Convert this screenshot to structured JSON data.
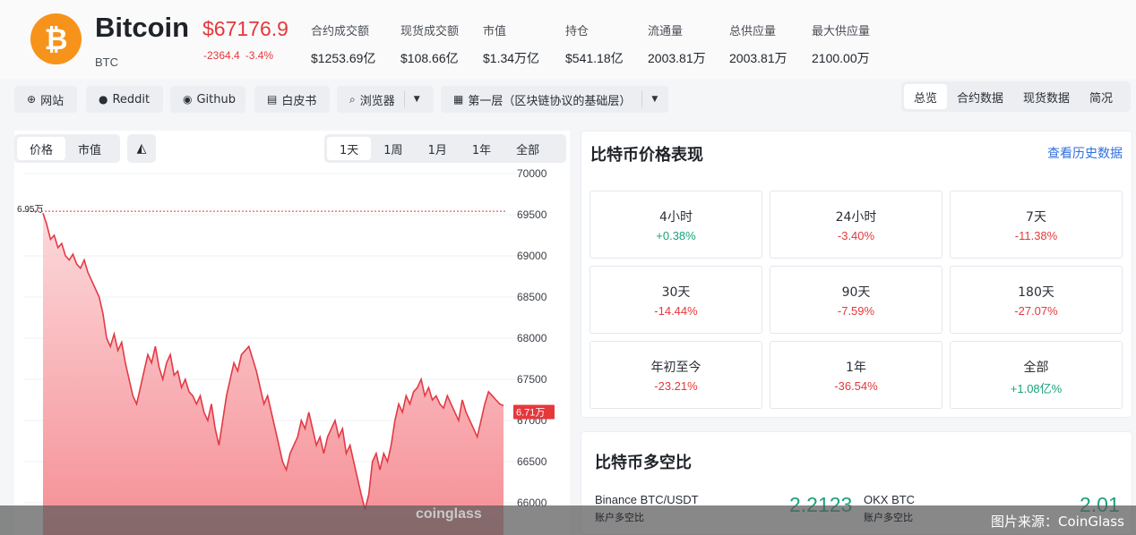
{
  "coin": {
    "name": "Bitcoin",
    "symbol": "BTC",
    "logo_glyph": "₿",
    "price": "$67176.9",
    "change_abs": "-2364.4",
    "change_pct": "-3.4%"
  },
  "stats": [
    {
      "label": "合约成交额",
      "value": "$1253.69亿"
    },
    {
      "label": "现货成交额",
      "value": "$108.66亿"
    },
    {
      "label": "市值",
      "value": "$1.34万亿"
    },
    {
      "label": "持仓",
      "value": "$541.18亿"
    },
    {
      "label": "流通量",
      "value": "2003.81万"
    },
    {
      "label": "总供应量",
      "value": "2003.81万"
    },
    {
      "label": "最大供应量",
      "value": "2100.00万"
    }
  ],
  "toolbar": {
    "website": "网站",
    "reddit": "Reddit",
    "github": "Github",
    "whitepaper": "白皮书",
    "explorer": "浏览器",
    "layer": "第一层（区块链协议的基础层）"
  },
  "main_tabs": [
    "总览",
    "合约数据",
    "现货数据",
    "简况"
  ],
  "chart_controls": {
    "metric_tabs": [
      "价格",
      "市值"
    ],
    "range_tabs": [
      "1天",
      "1周",
      "1月",
      "1年",
      "全部"
    ]
  },
  "chart_data": {
    "type": "area",
    "y_ticks": [
      "70000",
      "69500",
      "69000",
      "68500",
      "68000",
      "67500",
      "67000",
      "66500",
      "66000"
    ],
    "ylim": [
      65900,
      70000
    ],
    "grid": true,
    "start_label": "6.95万",
    "current_label": "6.71万",
    "watermark": "coinglass",
    "values": [
      69520,
      69380,
      69200,
      69250,
      69100,
      69150,
      69000,
      68950,
      69020,
      68900,
      68850,
      68950,
      68800,
      68700,
      68600,
      68500,
      68300,
      68000,
      67900,
      68050,
      67850,
      67950,
      67700,
      67500,
      67300,
      67200,
      67400,
      67600,
      67800,
      67700,
      67900,
      67650,
      67500,
      67700,
      67800,
      67550,
      67600,
      67400,
      67500,
      67350,
      67300,
      67200,
      67300,
      67100,
      67000,
      67200,
      66900,
      66700,
      67000,
      67300,
      67500,
      67700,
      67600,
      67800,
      67850,
      67900,
      67750,
      67600,
      67400,
      67200,
      67300,
      67100,
      66900,
      66700,
      66500,
      66400,
      66600,
      66700,
      66800,
      67000,
      66900,
      67100,
      66900,
      66700,
      66800,
      66600,
      66800,
      66900,
      67000,
      66800,
      66900,
      66600,
      66700,
      66500,
      66300,
      66100,
      65920,
      66100,
      66500,
      66600,
      66400,
      66600,
      66500,
      66700,
      67000,
      67200,
      67100,
      67300,
      67200,
      67350,
      67400,
      67500,
      67300,
      67400,
      67250,
      67300,
      67200,
      67150,
      67300,
      67200,
      67100,
      67000,
      67250,
      67100,
      67000,
      66900,
      66800,
      67000,
      67200,
      67350,
      67300,
      67250,
      67200,
      67180
    ]
  },
  "performance": {
    "title": "比特币价格表现",
    "link": "查看历史数据",
    "cells": [
      {
        "label": "4小时",
        "value": "+0.38%",
        "dir": "pos"
      },
      {
        "label": "24小时",
        "value": "-3.40%",
        "dir": "neg"
      },
      {
        "label": "7天",
        "value": "-11.38%",
        "dir": "neg"
      },
      {
        "label": "30天",
        "value": "-14.44%",
        "dir": "neg"
      },
      {
        "label": "90天",
        "value": "-7.59%",
        "dir": "neg"
      },
      {
        "label": "180天",
        "value": "-27.07%",
        "dir": "neg"
      },
      {
        "label": "年初至今",
        "value": "-23.21%",
        "dir": "neg"
      },
      {
        "label": "1年",
        "value": "-36.54%",
        "dir": "neg"
      },
      {
        "label": "全部",
        "value": "+1.08亿%",
        "dir": "pos"
      }
    ]
  },
  "long_short": {
    "title": "比特币多空比",
    "items": [
      {
        "exchange": "Binance BTC/USDT",
        "sub": "账户多空比",
        "ratio": "2.2123"
      },
      {
        "exchange": "OKX BTC",
        "sub": "账户多空比",
        "ratio": "2.01"
      }
    ]
  },
  "source": "图片来源：CoinGlass",
  "colors": {
    "accent_red": "#e5383b",
    "accent_green": "#1aa27a",
    "link_blue": "#2f6fdf",
    "bitcoin_orange": "#f7931a"
  }
}
